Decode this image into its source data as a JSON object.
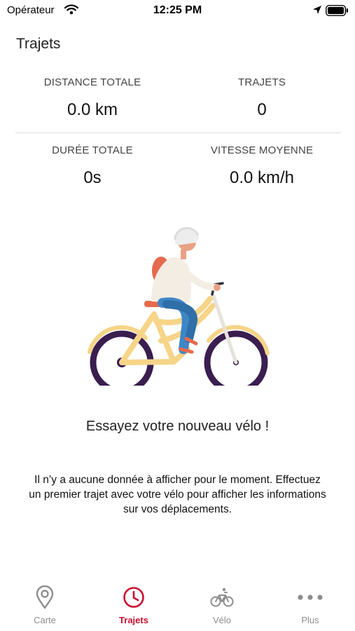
{
  "status_bar": {
    "carrier": "Opérateur",
    "time": "12:25 PM",
    "icons": [
      "wifi-icon",
      "location-arrow-icon",
      "battery-icon"
    ]
  },
  "header": {
    "title": "Trajets"
  },
  "stats": {
    "distance": {
      "label": "DISTANCE TOTALE",
      "value": "0.0 km"
    },
    "trips": {
      "label": "TRAJETS",
      "value": "0"
    },
    "duration": {
      "label": "DURÉE TOTALE",
      "value": "0s"
    },
    "speed": {
      "label": "VITESSE MOYENNE",
      "value": "0.0 km/h"
    }
  },
  "empty_state": {
    "illustration": "cyclist-illustration",
    "title": "Essayez votre nouveau vélo !",
    "message": "Il n’y a aucune donnée à afficher pour le moment. Effectuez un premier trajet avec votre vélo pour afficher les informations sur vos déplacements."
  },
  "tab_bar": {
    "active_color": "#c8102e",
    "inactive_color": "#8d8d8d",
    "tabs": [
      {
        "label": "Carte",
        "icon": "map-pin-icon",
        "active": false
      },
      {
        "label": "Trajets",
        "icon": "clock-icon",
        "active": true
      },
      {
        "label": "Vélo",
        "icon": "bike-icon",
        "active": false
      },
      {
        "label": "Plus",
        "icon": "more-icon",
        "active": false
      }
    ]
  }
}
